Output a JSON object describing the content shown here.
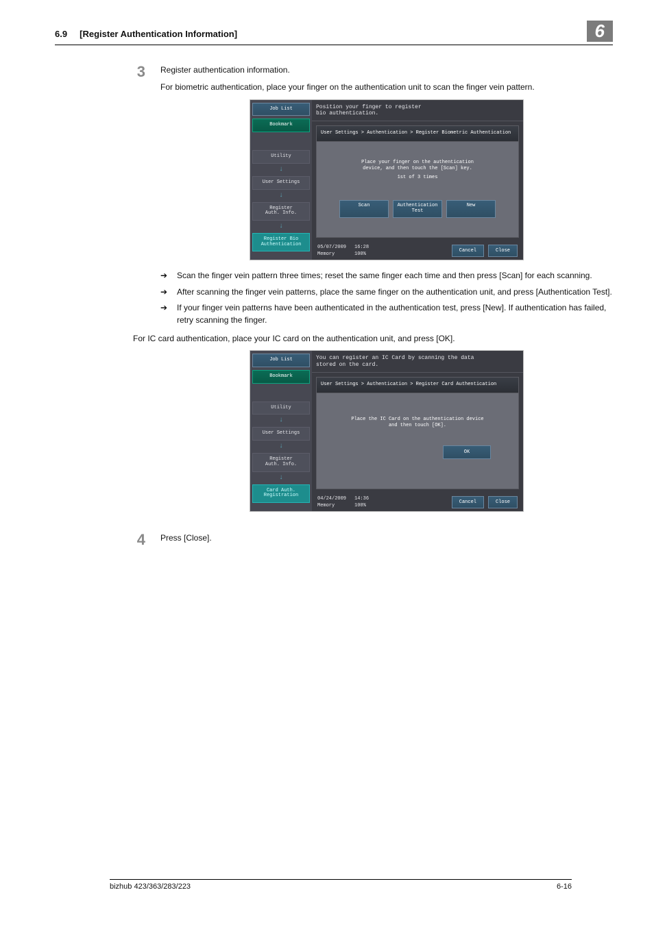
{
  "header": {
    "section_number": "6.9",
    "section_title": "[Register Authentication Information]",
    "chapter": "6"
  },
  "step3": {
    "num": "3",
    "title": "Register authentication information.",
    "intro": "For biometric authentication, place your finger on the authentication unit to scan the finger vein pattern.",
    "bullets": [
      "Scan the finger vein pattern three times; reset the same finger each time and then press [Scan] for each scanning.",
      "After scanning the finger vein patterns, place the same finger on the authentication unit, and press [Authentication Test].",
      "If your finger vein patterns have been authenticated in the authentication test, press [New]. If authentication has failed, retry scanning the finger."
    ],
    "ic_intro": "For IC card authentication, place your IC card on the authentication unit, and press [OK]."
  },
  "step4": {
    "num": "4",
    "text": "Press [Close]."
  },
  "shot_bio": {
    "title": "Position your finger to register\nbio authentication.",
    "crumb": "User Settings > Authentication > Register Biometric Authentication",
    "body_line1": "Place your finger on the authentication\ndevice, and then touch the [Scan] key.",
    "body_line2": "1st of 3 times",
    "actions": {
      "scan": "Scan",
      "auth_test": "Authentication\nTest",
      "new_btn": "New"
    },
    "sidebar": {
      "job": "Job List",
      "bookmark": "Bookmark",
      "utility": "Utility",
      "user_settings": "User Settings",
      "register_auth": "Register\nAuth. Info.",
      "register_bio": "Register Bio\nAuthentication"
    },
    "footer": {
      "date": "05/07/2009",
      "time": "16:28",
      "mem": "Memory",
      "pct": "100%",
      "cancel": "Cancel",
      "close": "Close"
    }
  },
  "shot_ic": {
    "title": "You can register an IC Card by scanning the data\nstored on the card.",
    "crumb": "User Settings > Authentication  > Register Card Authentication",
    "body_line1": "Place the IC Card on the authentication device\nand then touch [OK].",
    "ok": "OK",
    "sidebar": {
      "job": "Job List",
      "bookmark": "Bookmark",
      "utility": "Utility",
      "user_settings": "User Settings",
      "register_auth": "Register\nAuth. Info.",
      "card_reg": "Card Auth.\nRegistration"
    },
    "footer": {
      "date": "04/24/2009",
      "time": "14:36",
      "mem": "Memory",
      "pct": "100%",
      "cancel": "Cancel",
      "close": "Close"
    }
  },
  "footer": {
    "left": "bizhub 423/363/283/223",
    "right": "6-16"
  },
  "arrow_glyph": "➔",
  "down_glyph": "↓"
}
